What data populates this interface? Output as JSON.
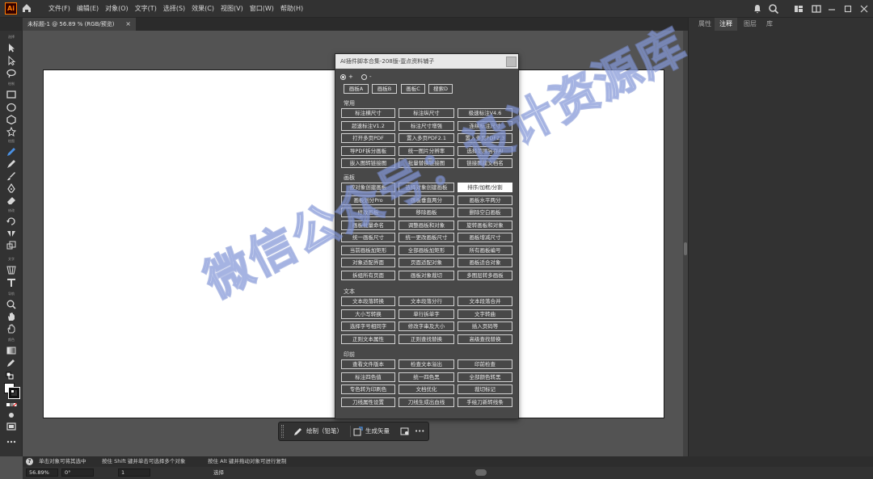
{
  "app": {
    "logo_text": "Ai"
  },
  "menu": [
    "文件(F)",
    "编辑(E)",
    "对象(O)",
    "文字(T)",
    "选择(S)",
    "效果(C)",
    "视图(V)",
    "窗口(W)",
    "帮助(H)"
  ],
  "document_tab": {
    "title": "未标题-1 @ 56.89 % (RGB/预览)",
    "close": "×"
  },
  "toolbar_labels": {
    "select": "选择",
    "draw": "绘制",
    "paint": "绘图",
    "modify": "修改",
    "type": "文字",
    "nav": "导航",
    "color": "颜色"
  },
  "right_panel_tabs": [
    "属性",
    "注释",
    "图层",
    "库"
  ],
  "right_panel_active": "注释",
  "plugin": {
    "title": "AI插件脚本合集-208版-壹点资料辅子",
    "radio_plus": "+",
    "radio_minus": "-",
    "top_buttons": [
      "画板A",
      "画板B",
      "画板C",
      "搜索D"
    ],
    "sections": [
      {
        "title": "常用",
        "buttons": [
          "标注横尺寸",
          "标注纵尺寸",
          "极速标注V4.6",
          "超速标注V1.2",
          "标注尺寸增强",
          "连续标注尺寸",
          "打开多页PDF",
          "置入多页PDF2.1",
          "置入多页PDF2.3",
          "导PDF拆分画板",
          "统一图片分辨率",
          "选择范围另存AI",
          "嵌入图转链接图",
          "批量替换链接图",
          "链接图建文档名"
        ]
      },
      {
        "title": "画板",
        "buttons": [
          "按对象创建画板",
          "选择对象创建画板",
          "排序/加框/分割",
          "画板划分Pro",
          "画板垂直两分",
          "画板水平两分",
          "修改画板",
          "移除画板",
          "删除空白画板",
          "画板批量命名",
          "调整画板和对象",
          "旋转画板和对象",
          "统一画板尺寸",
          "统一更改画板尺寸",
          "画板增减尺寸",
          "当前画板加矩形",
          "全部画板加矩形",
          "所有画板编号",
          "对象适配界面",
          "页面适配对象",
          "画板适合对象",
          "拆组所有页面",
          "画板对象裁切",
          "多图层转多画板"
        ]
      },
      {
        "title": "文本",
        "buttons": [
          "文本段落转换",
          "文本段落分行",
          "文本段落合并",
          "大小写转换",
          "单行拆单字",
          "文字转曲",
          "选择字号相同字",
          "修改字串及大小",
          "插入页码等",
          "正则文本属性",
          "正则查找替换",
          "高级查找替换"
        ]
      },
      {
        "title": "印前",
        "buttons": [
          "查看文件版本",
          "检查文本溢出",
          "印前检查",
          "标注四色值",
          "统一四色黑",
          "全部颜色转黑",
          "专色转为印刷色",
          "文档优化",
          "裁切标记",
          "刀线属性设置",
          "刀线生成出血线",
          "手绘刀新转线条"
        ]
      }
    ],
    "highlighted": "排序/加框/分割"
  },
  "context_bar": {
    "draw_label": "绘制（铅笔）",
    "vectorize_label": "生成矢量",
    "more": "•••"
  },
  "hint_bar": {
    "text1": "单击对象可将其选中",
    "text2": "按住 Shift 键并单击可选择多个对象",
    "text3": "按住 Alt 键并拖动对象可进行复制"
  },
  "status_bar": {
    "zoom": "56.89%",
    "rotation": "0°",
    "page": "1",
    "mode": "选择"
  },
  "watermark": "微信公众号：设计资源库"
}
